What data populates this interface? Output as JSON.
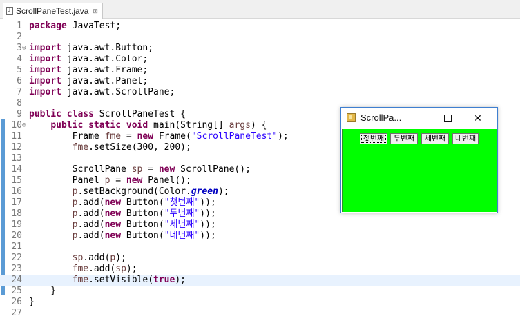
{
  "tab": {
    "title": "ScrollPaneTest.java",
    "close": "⊠"
  },
  "editor": {
    "lines": [
      {
        "num": "1",
        "fold": "",
        "tokens": [
          [
            "kw",
            "package"
          ],
          [
            "p",
            " JavaTest;"
          ]
        ]
      },
      {
        "num": "2",
        "fold": "",
        "tokens": []
      },
      {
        "num": "3",
        "fold": "⊖",
        "tokens": [
          [
            "kw",
            "import"
          ],
          [
            "p",
            " java.awt.Button;"
          ]
        ]
      },
      {
        "num": "4",
        "fold": "",
        "tokens": [
          [
            "kw",
            "import"
          ],
          [
            "p",
            " java.awt.Color;"
          ]
        ]
      },
      {
        "num": "5",
        "fold": "",
        "tokens": [
          [
            "kw",
            "import"
          ],
          [
            "p",
            " java.awt.Frame;"
          ]
        ]
      },
      {
        "num": "6",
        "fold": "",
        "tokens": [
          [
            "kw",
            "import"
          ],
          [
            "p",
            " java.awt.Panel;"
          ]
        ]
      },
      {
        "num": "7",
        "fold": "",
        "tokens": [
          [
            "kw",
            "import"
          ],
          [
            "p",
            " java.awt.ScrollPane;"
          ]
        ]
      },
      {
        "num": "8",
        "fold": "",
        "tokens": []
      },
      {
        "num": "9",
        "fold": "",
        "tokens": [
          [
            "kw",
            "public"
          ],
          [
            "p",
            " "
          ],
          [
            "kw",
            "class"
          ],
          [
            "p",
            " ScrollPaneTest {"
          ]
        ]
      },
      {
        "num": "10",
        "fold": "⊖",
        "tokens": [
          [
            "p",
            "    "
          ],
          [
            "kw",
            "public"
          ],
          [
            "p",
            " "
          ],
          [
            "kw",
            "static"
          ],
          [
            "p",
            " "
          ],
          [
            "kw",
            "void"
          ],
          [
            "p",
            " main(String[] "
          ],
          [
            "var",
            "args"
          ],
          [
            "p",
            ") {"
          ]
        ]
      },
      {
        "num": "11",
        "fold": "",
        "tokens": [
          [
            "p",
            "        Frame "
          ],
          [
            "var",
            "fme"
          ],
          [
            "p",
            " = "
          ],
          [
            "kw",
            "new"
          ],
          [
            "p",
            " Frame("
          ],
          [
            "str",
            "\"ScrollPaneTest\""
          ],
          [
            "p",
            ");"
          ]
        ]
      },
      {
        "num": "12",
        "fold": "",
        "tokens": [
          [
            "p",
            "        "
          ],
          [
            "var",
            "fme"
          ],
          [
            "p",
            ".setSize(300, 200);"
          ]
        ]
      },
      {
        "num": "13",
        "fold": "",
        "tokens": []
      },
      {
        "num": "14",
        "fold": "",
        "tokens": [
          [
            "p",
            "        ScrollPane "
          ],
          [
            "var",
            "sp"
          ],
          [
            "p",
            " = "
          ],
          [
            "kw",
            "new"
          ],
          [
            "p",
            " ScrollPane();"
          ]
        ]
      },
      {
        "num": "15",
        "fold": "",
        "tokens": [
          [
            "p",
            "        Panel "
          ],
          [
            "var",
            "p"
          ],
          [
            "p",
            " = "
          ],
          [
            "kw",
            "new"
          ],
          [
            "p",
            " Panel();"
          ]
        ]
      },
      {
        "num": "16",
        "fold": "",
        "tokens": [
          [
            "p",
            "        "
          ],
          [
            "var",
            "p"
          ],
          [
            "p",
            ".setBackground(Color."
          ],
          [
            "fld",
            "green"
          ],
          [
            "p",
            ");"
          ]
        ]
      },
      {
        "num": "17",
        "fold": "",
        "tokens": [
          [
            "p",
            "        "
          ],
          [
            "var",
            "p"
          ],
          [
            "p",
            ".add("
          ],
          [
            "kw",
            "new"
          ],
          [
            "p",
            " Button("
          ],
          [
            "str",
            "\"첫번째\""
          ],
          [
            "p",
            "));"
          ]
        ]
      },
      {
        "num": "18",
        "fold": "",
        "tokens": [
          [
            "p",
            "        "
          ],
          [
            "var",
            "p"
          ],
          [
            "p",
            ".add("
          ],
          [
            "kw",
            "new"
          ],
          [
            "p",
            " Button("
          ],
          [
            "str",
            "\"두번째\""
          ],
          [
            "p",
            "));"
          ]
        ]
      },
      {
        "num": "19",
        "fold": "",
        "tokens": [
          [
            "p",
            "        "
          ],
          [
            "var",
            "p"
          ],
          [
            "p",
            ".add("
          ],
          [
            "kw",
            "new"
          ],
          [
            "p",
            " Button("
          ],
          [
            "str",
            "\"세번째\""
          ],
          [
            "p",
            "));"
          ]
        ]
      },
      {
        "num": "20",
        "fold": "",
        "tokens": [
          [
            "p",
            "        "
          ],
          [
            "var",
            "p"
          ],
          [
            "p",
            ".add("
          ],
          [
            "kw",
            "new"
          ],
          [
            "p",
            " Button("
          ],
          [
            "str",
            "\"네번째\""
          ],
          [
            "p",
            "));"
          ]
        ]
      },
      {
        "num": "21",
        "fold": "",
        "tokens": []
      },
      {
        "num": "22",
        "fold": "",
        "tokens": [
          [
            "p",
            "        "
          ],
          [
            "var",
            "sp"
          ],
          [
            "p",
            ".add("
          ],
          [
            "var",
            "p"
          ],
          [
            "p",
            ");"
          ]
        ]
      },
      {
        "num": "23",
        "fold": "",
        "tokens": [
          [
            "p",
            "        "
          ],
          [
            "var",
            "fme"
          ],
          [
            "p",
            ".add("
          ],
          [
            "var",
            "sp"
          ],
          [
            "p",
            ");"
          ]
        ]
      },
      {
        "num": "24",
        "fold": "",
        "tokens": [
          [
            "p",
            "        "
          ],
          [
            "var",
            "fme"
          ],
          [
            "p",
            ".setVisible("
          ],
          [
            "kw",
            "true"
          ],
          [
            "p",
            ");"
          ]
        ],
        "current": true
      },
      {
        "num": "25",
        "fold": "",
        "tokens": [
          [
            "p",
            "    }"
          ]
        ]
      },
      {
        "num": "26",
        "fold": "",
        "tokens": [
          [
            "p",
            "}"
          ]
        ]
      },
      {
        "num": "27",
        "fold": "",
        "tokens": []
      }
    ]
  },
  "popup": {
    "title": "ScrollPa...",
    "minimize": "—",
    "close": "✕",
    "background": "#00ff00",
    "buttons": [
      "첫번째",
      "두번째",
      "세번째",
      "네번째"
    ]
  }
}
